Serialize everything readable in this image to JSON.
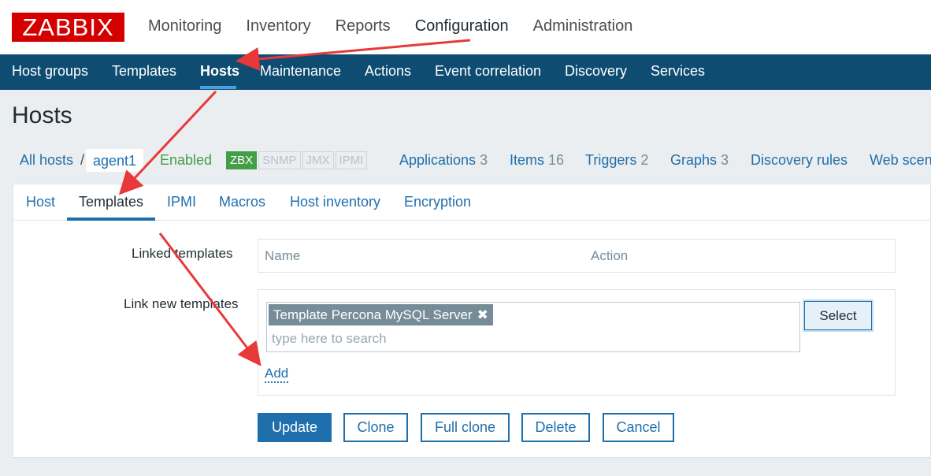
{
  "app": {
    "logo": "ZABBIX"
  },
  "top_nav": {
    "items": [
      "Monitoring",
      "Inventory",
      "Reports",
      "Configuration",
      "Administration"
    ],
    "active": "Configuration"
  },
  "sub_nav": {
    "items": [
      "Host groups",
      "Templates",
      "Hosts",
      "Maintenance",
      "Actions",
      "Event correlation",
      "Discovery",
      "Services"
    ],
    "active": "Hosts"
  },
  "page": {
    "title": "Hosts"
  },
  "host_bar": {
    "all_hosts": "All hosts",
    "separator": "/",
    "host_name": "agent1",
    "status": "Enabled",
    "availability": [
      "ZBX",
      "SNMP",
      "JMX",
      "IPMI"
    ],
    "links": [
      {
        "label": "Applications",
        "count": "3"
      },
      {
        "label": "Items",
        "count": "16"
      },
      {
        "label": "Triggers",
        "count": "2"
      },
      {
        "label": "Graphs",
        "count": "3"
      },
      {
        "label": "Discovery rules",
        "count": ""
      },
      {
        "label": "Web scen",
        "count": ""
      }
    ]
  },
  "tabs": {
    "items": [
      "Host",
      "Templates",
      "IPMI",
      "Macros",
      "Host inventory",
      "Encryption"
    ],
    "active": "Templates"
  },
  "form": {
    "linked_label": "Linked templates",
    "linked_headers": {
      "name": "Name",
      "action": "Action"
    },
    "new_label": "Link new templates",
    "selected_template": "Template Percona MySQL Server",
    "remove_glyph": "✖",
    "search_placeholder": "type here to search",
    "select_button": "Select",
    "add_link": "Add"
  },
  "actions": {
    "update": "Update",
    "clone": "Clone",
    "full_clone": "Full clone",
    "delete": "Delete",
    "cancel": "Cancel"
  },
  "colors": {
    "brand": "#d40000",
    "nav_bg": "#0e4c72",
    "link": "#1f6fad",
    "enabled": "#429e47",
    "annotation_arrow": "#e8393a"
  }
}
